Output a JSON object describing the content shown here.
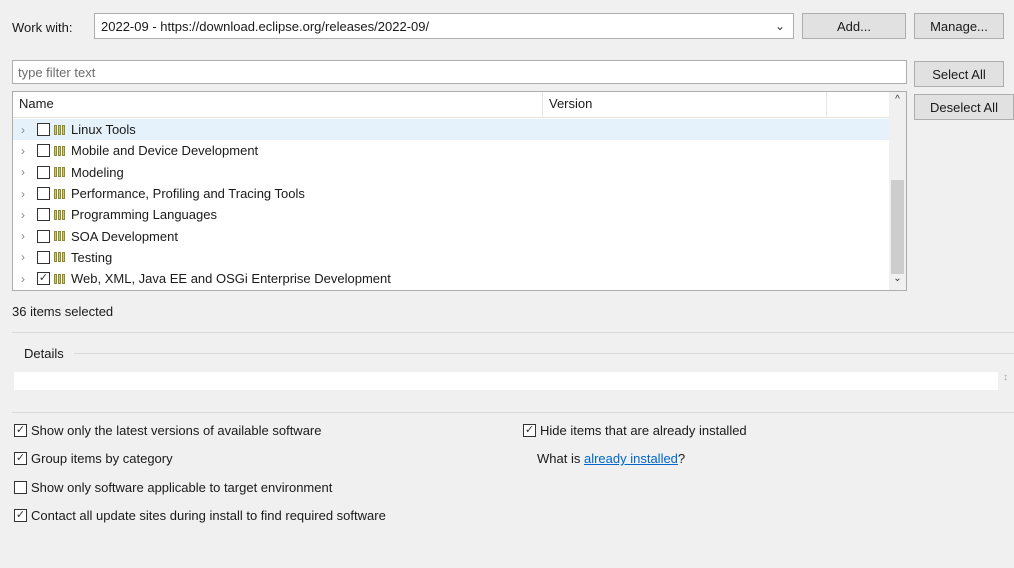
{
  "work_with": {
    "label": "Work with:",
    "value": "2022-09 - https://download.eclipse.org/releases/2022-09/",
    "add_label": "Add...",
    "manage_label": "Manage..."
  },
  "filter": {
    "placeholder": "type filter text"
  },
  "buttons": {
    "select_all": "Select All",
    "deselect_all": "Deselect All"
  },
  "tree": {
    "columns": [
      "Name",
      "Version",
      ""
    ],
    "rows": [
      {
        "label": "Linux Tools",
        "checked": false,
        "selected": true
      },
      {
        "label": "Mobile and Device Development",
        "checked": false,
        "selected": false
      },
      {
        "label": "Modeling",
        "checked": false,
        "selected": false
      },
      {
        "label": "Performance, Profiling and Tracing Tools",
        "checked": false,
        "selected": false
      },
      {
        "label": "Programming Languages",
        "checked": false,
        "selected": false
      },
      {
        "label": "SOA Development",
        "checked": false,
        "selected": false
      },
      {
        "label": "Testing",
        "checked": false,
        "selected": false
      },
      {
        "label": "Web, XML, Java EE and OSGi Enterprise Development",
        "checked": true,
        "selected": false
      }
    ]
  },
  "status": "36 items selected",
  "details": {
    "label": "Details"
  },
  "options": {
    "latest_versions": {
      "label": "Show only the latest versions of available software",
      "checked": true
    },
    "group_by_category": {
      "label": "Group items by category",
      "checked": true
    },
    "target_env": {
      "label": "Show only software applicable to target environment",
      "checked": false
    },
    "contact_sites": {
      "label": "Contact all update sites during install to find required software",
      "checked": true
    },
    "hide_installed": {
      "label": "Hide items that are already installed",
      "checked": true
    }
  },
  "what_installed": {
    "prefix": "What is ",
    "link": "already installed",
    "suffix": "?"
  },
  "colors": {
    "selection": "#e5f1fb",
    "link": "#0066cc"
  },
  "icons": [
    "chevron-down-icon",
    "expand-arrow-icon",
    "checkbox-icon",
    "package-icon",
    "scroll-up-icon",
    "scroll-down-icon"
  ]
}
